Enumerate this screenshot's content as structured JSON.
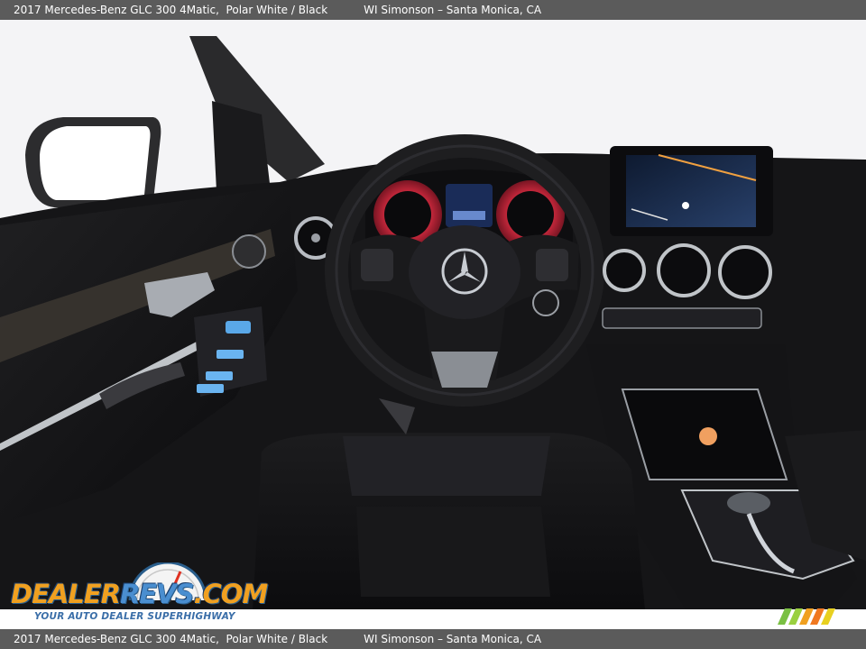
{
  "caption": {
    "vehicle": "2017 Mercedes-Benz GLC 300 4Matic,  Polar White / Black",
    "dealer": "WI Simonson – Santa Monica, CA"
  },
  "photo": {
    "subject": "interior dashboard view",
    "colors": {
      "interior": "#141416",
      "trim": "#c0c4c8",
      "ambient_red": "#c8283c",
      "screen": "#1a2c48",
      "background": "#f4f4f6"
    }
  },
  "watermark": {
    "logo_left": "DEALER",
    "logo_right": "REVS",
    "logo_suffix": ".COM",
    "tagline": "YOUR AUTO DEALER SUPERHIGHWAY"
  },
  "colors": {
    "caption_bg": "#5b5b5b",
    "caption_text": "#ffffff",
    "logo_orange": "#f0a020",
    "logo_blue": "#4a8ed0"
  }
}
